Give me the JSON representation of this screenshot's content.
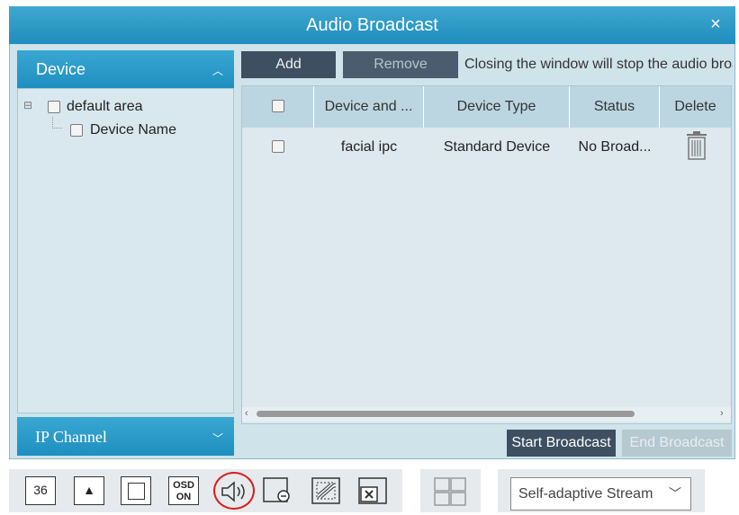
{
  "window": {
    "title": "Audio Broadcast",
    "close_glyph": "×"
  },
  "left_panel": {
    "device_header": "Device",
    "ip_channel_header": "IP Channel",
    "tree": {
      "root_label": "default area",
      "child_label": "Device Name",
      "collapse_glyph": "⊟"
    }
  },
  "toolbar": {
    "add_label": "Add",
    "remove_label": "Remove",
    "note": "Closing the window will stop the audio broadcast"
  },
  "table": {
    "columns": [
      "Device and ...",
      "Device Type",
      "Status",
      "Delete"
    ],
    "rows": [
      {
        "name": "facial ipc",
        "type": "Standard Device",
        "status": "No Broad..."
      }
    ]
  },
  "actions": {
    "start_label": "Start Broadcast",
    "end_label": "End Broadcast"
  },
  "bottom_toolbar": {
    "icons": [
      "split-36-icon",
      "ptz-up-icon",
      "fullscreen-icon",
      "osd-on-icon",
      "audio-broadcast-icon",
      "record-icon",
      "image-adjust-icon",
      "close-window-icon",
      "layout-icon"
    ],
    "split_label": "36",
    "osd_label_1": "OSD",
    "osd_label_2": "ON",
    "stream_label": "Self-adaptive Stream"
  },
  "colors": {
    "accent": "#1f8dbe",
    "dark_button": "#3d4f60",
    "highlight": "#d81e1e"
  }
}
